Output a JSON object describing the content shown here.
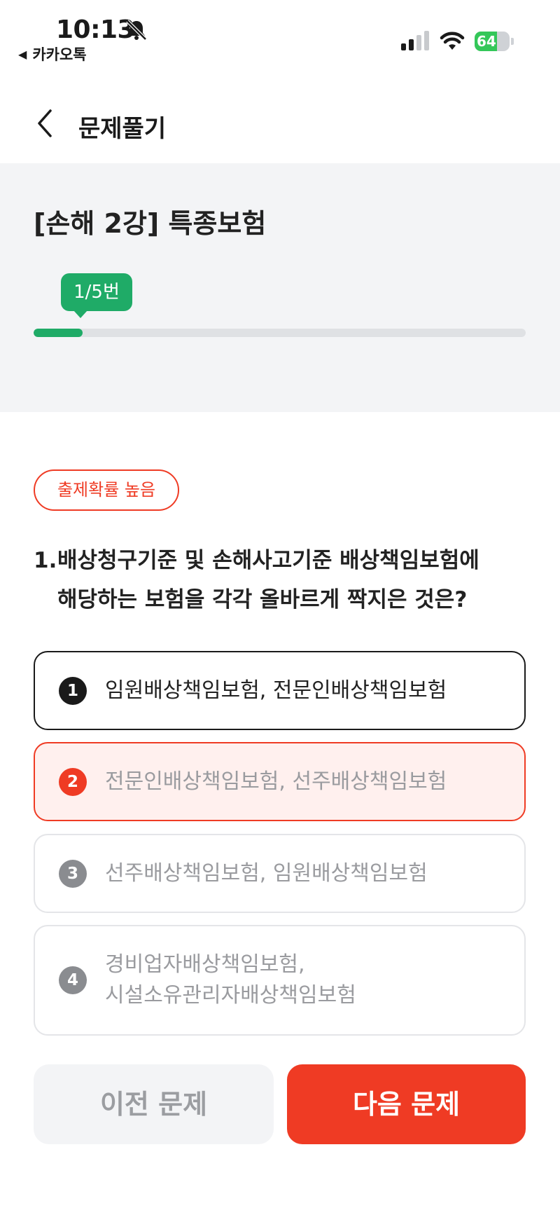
{
  "status_bar": {
    "time": "10:13",
    "back_app": "카카오톡",
    "battery": "64",
    "battery_level": 0.64,
    "icons": [
      "bell-slash-icon",
      "signal-icon",
      "wifi-icon",
      "battery-icon"
    ]
  },
  "header": {
    "title": "문제풀기"
  },
  "lesson": {
    "title": "[손해 2강] 특종보험",
    "progress_label": "1/5번",
    "progress_fraction": 0.1
  },
  "badge": {
    "label": "출제확률 높음"
  },
  "question": {
    "number": "1.",
    "line1": "배상청구기준 및 손해사고기준 배상책임보험에",
    "line2": "해당하는 보험을 각각 올바르게 짝지은 것은?"
  },
  "options": [
    {
      "num": "1",
      "line1": "임원배상책임보험, 전문인배상책임보험",
      "line2": ""
    },
    {
      "num": "2",
      "line1": "전문인배상책임보험, 선주배상책임보험",
      "line2": ""
    },
    {
      "num": "3",
      "line1": "선주배상책임보험, 임원배상책임보험",
      "line2": ""
    },
    {
      "num": "4",
      "line1": "경비업자배상책임보험,",
      "line2": "시설소유관리자배상책임보험"
    }
  ],
  "buttons": {
    "prev": "이전 문제",
    "next": "다음 문제"
  },
  "colors": {
    "accent_green": "#1fab67",
    "accent_red": "#ef3b24",
    "panel_grey": "#f3f4f6"
  }
}
